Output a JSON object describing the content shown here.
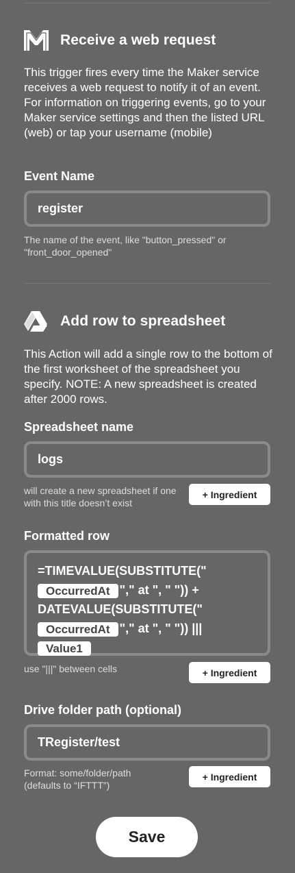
{
  "trigger": {
    "icon": "maker-m-icon",
    "title": "Receive a web request",
    "description": "This trigger fires every time the Maker service receives a web request to notify it of an event. For information on triggering events, go to your Maker service settings and then the listed URL (web) or tap your username (mobile)",
    "event_name": {
      "label": "Event Name",
      "value": "register",
      "help": "The name of the event, like \"button_pressed\" or \"front_door_opened\""
    }
  },
  "action": {
    "icon": "google-drive-icon",
    "title": "Add row to spreadsheet",
    "description": "This Action will add a single row to the bottom of the first worksheet of the spreadsheet you specify. NOTE: A new spreadsheet is created after 2000 rows.",
    "spreadsheet_name": {
      "label": "Spreadsheet name",
      "value": "logs",
      "help": "will create a new spreadsheet if one with this title doesn’t exist",
      "ingredient_button": "+ Ingredient"
    },
    "formatted_row": {
      "label": "Formatted row",
      "line1": "=TIMEVALUE(SUBSTITUTE(\"",
      "ingredient1": "OccurredAt",
      "line2_rest": "\",\" at \", \" \")) +",
      "line3": "DATEVALUE(SUBSTITUTE(\"",
      "ingredient2": "OccurredAt",
      "line4_rest": "\",\" at \", \" \")) |||",
      "ingredient3": "Value1",
      "help": "use \"|||\" between cells",
      "ingredient_button": "+ Ingredient"
    },
    "drive_folder_path": {
      "label": "Drive folder path (optional)",
      "value": "TRegister/test",
      "help": "Format: some/folder/path (defaults to “IFTTT”)",
      "ingredient_button": "+ Ingredient"
    }
  },
  "save_label": "Save",
  "colors": {
    "background": "#666666",
    "field_border": "#8a8a8a",
    "text": "#ffffff",
    "button_bg": "#ffffff",
    "button_text": "#222222"
  }
}
